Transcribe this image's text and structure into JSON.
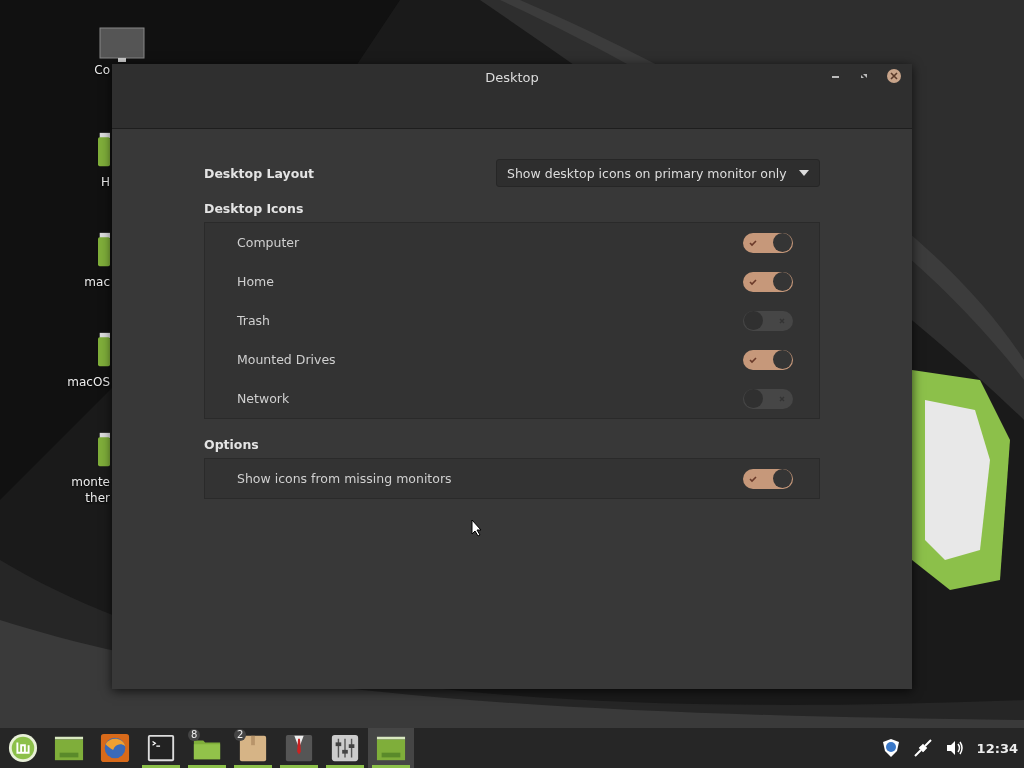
{
  "desktop_icons": [
    {
      "label": "Co",
      "kind": "monitor"
    },
    {
      "label": "H",
      "kind": "drive"
    },
    {
      "label": "mac",
      "kind": "drive"
    },
    {
      "label": "macOS",
      "kind": "drive"
    },
    {
      "label": "monte",
      "label2": "ther",
      "kind": "drive"
    }
  ],
  "window": {
    "title": "Desktop"
  },
  "layout": {
    "label": "Desktop Layout",
    "value": "Show desktop icons on primary monitor only"
  },
  "sections": [
    {
      "title": "Desktop Icons",
      "items": [
        {
          "label": "Computer",
          "on": true
        },
        {
          "label": "Home",
          "on": true
        },
        {
          "label": "Trash",
          "on": false
        },
        {
          "label": "Mounted Drives",
          "on": true
        },
        {
          "label": "Network",
          "on": false
        }
      ]
    },
    {
      "title": "Options",
      "items": [
        {
          "label": "Show icons from missing monitors",
          "on": true
        }
      ]
    }
  ],
  "taskbar": {
    "launchers": [
      {
        "kind": "menu",
        "running": false,
        "selected": false
      },
      {
        "kind": "desktop",
        "running": false,
        "selected": false
      },
      {
        "kind": "browser",
        "running": false,
        "selected": false
      },
      {
        "kind": "terminal",
        "running": true,
        "selected": false
      },
      {
        "kind": "folder",
        "badge": "8",
        "running": true,
        "selected": false
      },
      {
        "kind": "package",
        "badge": "2",
        "running": true,
        "selected": false
      },
      {
        "kind": "suit",
        "running": true,
        "selected": false
      },
      {
        "kind": "mixer",
        "running": true,
        "selected": false
      },
      {
        "kind": "desktop",
        "running": true,
        "selected": true
      }
    ],
    "clock": "12:34"
  }
}
